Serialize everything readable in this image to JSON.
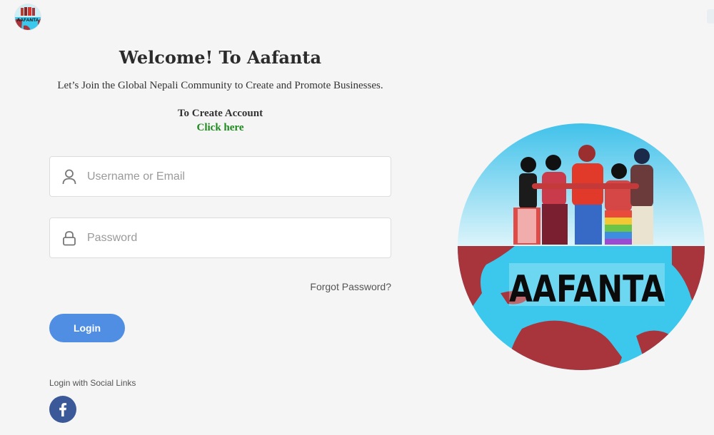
{
  "header": {
    "logo_text": "AAFANTA"
  },
  "main": {
    "title": "Welcome! To Aafanta",
    "subtitle": "Let’s Join the Global Nepali Community to Create and Promote Businesses.",
    "create_account_label": "To Create Account",
    "create_account_link": "Click here"
  },
  "form": {
    "username_placeholder": "Username or Email",
    "username_value": "",
    "password_placeholder": "Password",
    "password_value": "",
    "forgot_password_label": "Forgot Password?",
    "login_label": "Login"
  },
  "social": {
    "label": "Login with Social Links",
    "icons": [
      "facebook-icon"
    ]
  },
  "hero": {
    "brand_text": "AAFANTA"
  },
  "colors": {
    "primary_button": "#4f8ee2",
    "link_green": "#1e8a1e",
    "facebook_blue": "#3b5998",
    "ocean": "#3cc8ec",
    "land": "#a8343c",
    "background": "#f5f5f5"
  }
}
